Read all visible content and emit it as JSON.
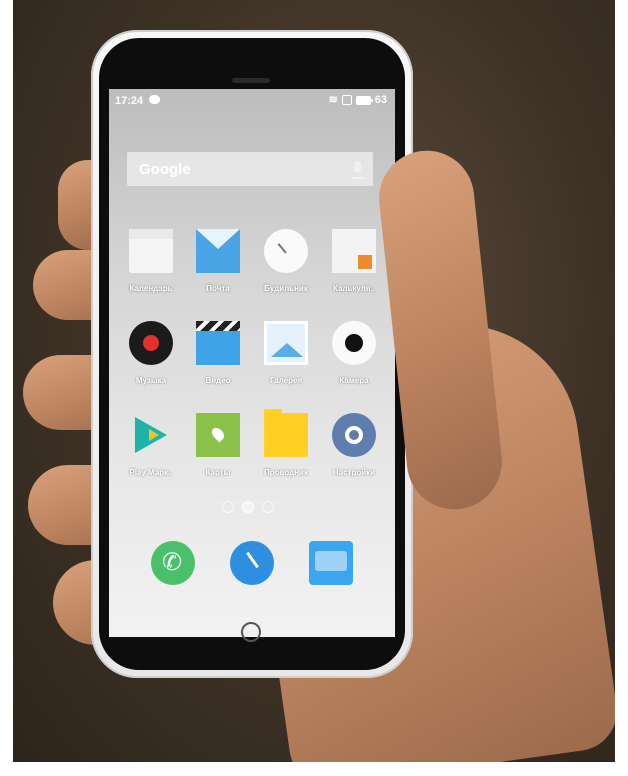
{
  "status_bar": {
    "time": "17:24",
    "battery": "63",
    "icons": [
      "chat-icon",
      "wifi-icon",
      "sim-icon",
      "battery-icon"
    ]
  },
  "search": {
    "logo": "Google",
    "mic_icon": "mic-icon"
  },
  "apps": [
    {
      "label": "Календарь",
      "icon": "calendar-icon"
    },
    {
      "label": "Почта",
      "icon": "mail-icon"
    },
    {
      "label": "Будильник",
      "icon": "clock-icon"
    },
    {
      "label": "Калькуля..",
      "icon": "calculator-icon"
    },
    {
      "label": "Музыка",
      "icon": "music-icon"
    },
    {
      "label": "Видео",
      "icon": "video-icon"
    },
    {
      "label": "Галерея",
      "icon": "gallery-icon"
    },
    {
      "label": "Камера",
      "icon": "camera-icon"
    },
    {
      "label": "Play Марк..",
      "icon": "play-store-icon"
    },
    {
      "label": "Карты",
      "icon": "maps-icon"
    },
    {
      "label": "Проводник",
      "icon": "file-manager-icon"
    },
    {
      "label": "Настройки",
      "icon": "settings-icon"
    }
  ],
  "page_indicator": {
    "pages": 3,
    "active": 2
  },
  "dock": [
    {
      "icon": "phone-icon"
    },
    {
      "icon": "browser-icon"
    },
    {
      "icon": "messages-icon"
    }
  ]
}
